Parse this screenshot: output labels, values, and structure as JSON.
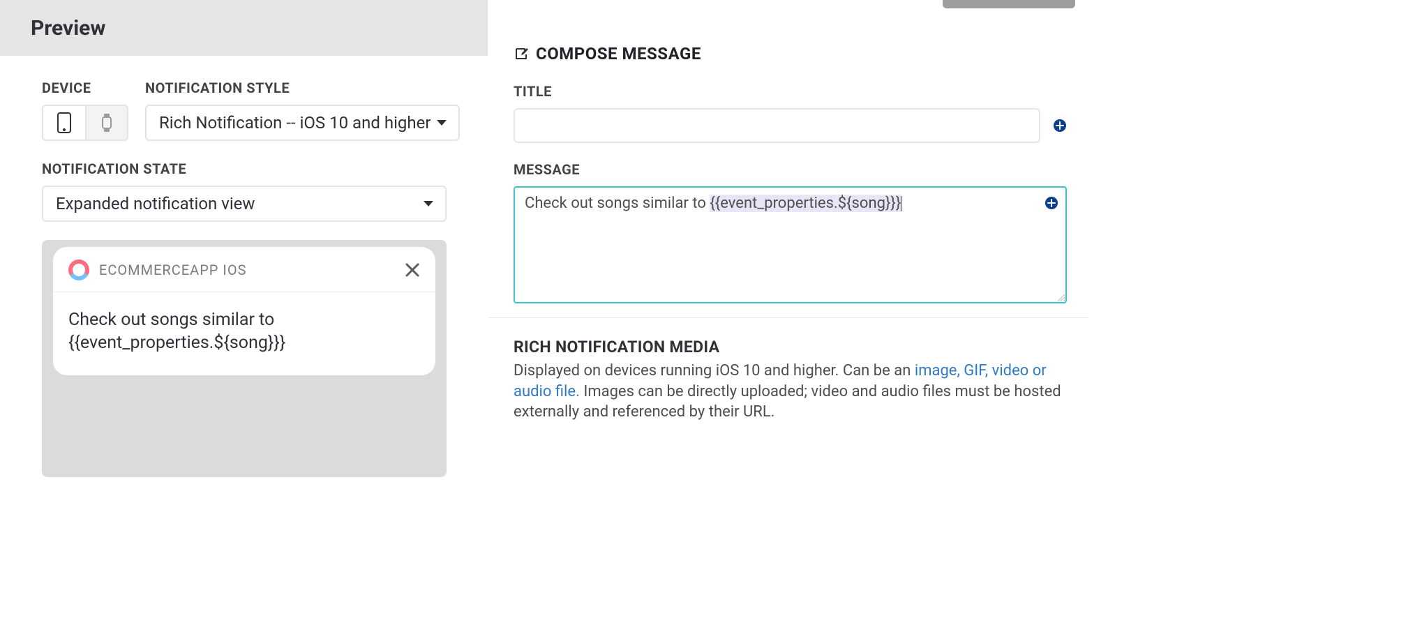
{
  "preview": {
    "title": "Preview",
    "device_label": "DEVICE",
    "style_label": "NOTIFICATION STYLE",
    "style_value": "Rich Notification -- iOS 10 and higher",
    "state_label": "NOTIFICATION STATE",
    "state_value": "Expanded notification view",
    "card": {
      "app_name": "ECOMMERCEAPP IOS",
      "message": "Check out songs similar to {{event_properties.${song}}}"
    }
  },
  "compose": {
    "icon": "edit",
    "heading": "COMPOSE MESSAGE",
    "title_label": "TITLE",
    "title_value": "",
    "message_label": "MESSAGE",
    "message_plain": "Check out songs similar to ",
    "message_token": "{{event_properties.${song}}}"
  },
  "media": {
    "heading": "RICH NOTIFICATION MEDIA",
    "desc_before": "Displayed on devices running iOS 10 and higher. Can be an ",
    "desc_link": "image, GIF, video or audio file.",
    "desc_after": " Images can be directly uploaded; video and audio files must be hosted externally and referenced by their URL."
  }
}
